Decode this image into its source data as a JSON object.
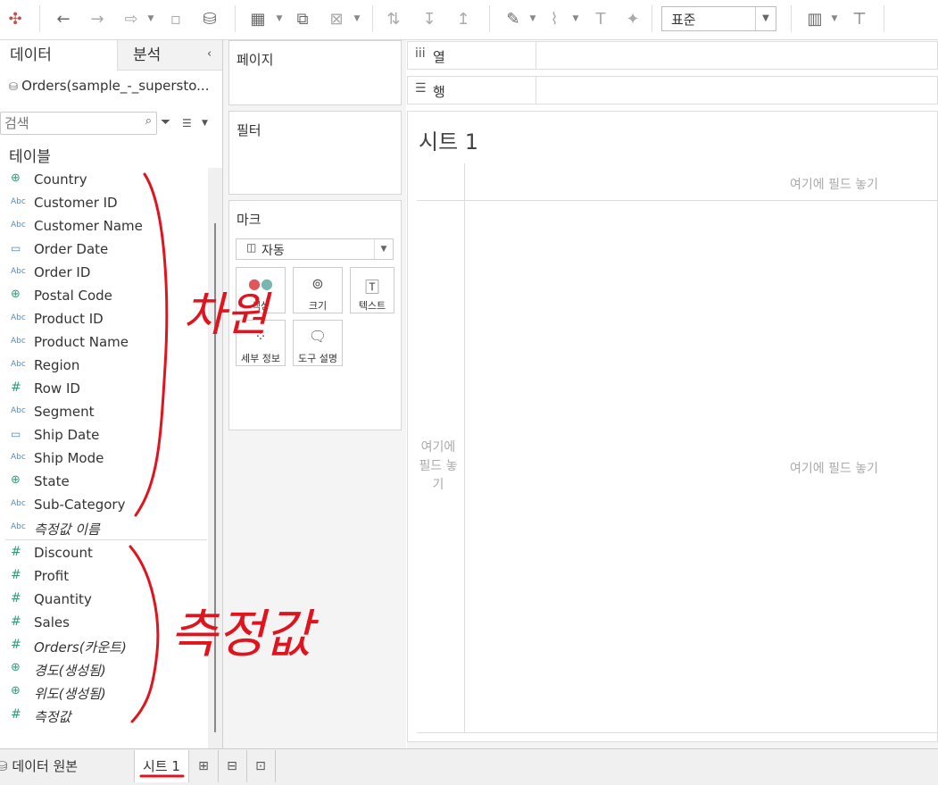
{
  "toolbar": {
    "buttons": [
      "tableau-logo-icon",
      "undo-icon",
      "redo-icon",
      "replay-icon",
      "save-icon",
      "new-datasource-icon",
      "new-worksheet-icon",
      "duplicate-icon",
      "clear-icon",
      "swap-icon",
      "sort-asc-icon",
      "sort-desc-icon",
      "highlight-icon",
      "group-icon",
      "labels-icon",
      "pin-icon",
      "show-me-icon",
      "presentation-icon"
    ],
    "fit_select": "표준"
  },
  "data_pane": {
    "tab_data": "데이터",
    "tab_analysis": "분석",
    "datasource": "Orders(sample_-_supersto...",
    "search_placeholder": "검색",
    "tables_label": "테이블",
    "dimensions": [
      {
        "type": "geo",
        "icon": "⊕",
        "name": "Country"
      },
      {
        "type": "abc",
        "icon": "Abc",
        "name": "Customer ID"
      },
      {
        "type": "abc",
        "icon": "Abc",
        "name": "Customer Name"
      },
      {
        "type": "date",
        "icon": "▭",
        "name": "Order Date"
      },
      {
        "type": "abc",
        "icon": "Abc",
        "name": "Order ID"
      },
      {
        "type": "geo",
        "icon": "⊕",
        "name": "Postal Code"
      },
      {
        "type": "abc",
        "icon": "Abc",
        "name": "Product ID"
      },
      {
        "type": "abc",
        "icon": "Abc",
        "name": "Product Name"
      },
      {
        "type": "abc",
        "icon": "Abc",
        "name": "Region"
      },
      {
        "type": "num",
        "icon": "#",
        "name": "Row ID"
      },
      {
        "type": "abc",
        "icon": "Abc",
        "name": "Segment"
      },
      {
        "type": "date",
        "icon": "▭",
        "name": "Ship Date"
      },
      {
        "type": "abc",
        "icon": "Abc",
        "name": "Ship Mode"
      },
      {
        "type": "geo",
        "icon": "⊕",
        "name": "State"
      },
      {
        "type": "abc",
        "icon": "Abc",
        "name": "Sub-Category"
      },
      {
        "type": "abc",
        "icon": "Abc",
        "name": "측정값 이름",
        "italic": true
      }
    ],
    "measures": [
      {
        "type": "num",
        "icon": "#",
        "name": "Discount"
      },
      {
        "type": "num",
        "icon": "#",
        "name": "Profit"
      },
      {
        "type": "num",
        "icon": "#",
        "name": "Quantity"
      },
      {
        "type": "num",
        "icon": "#",
        "name": "Sales"
      },
      {
        "type": "num",
        "icon": "#",
        "name": "Orders(카운트)",
        "italic": true
      },
      {
        "type": "geo",
        "icon": "⊕",
        "name": "경도(생성됨)",
        "italic": true
      },
      {
        "type": "geo",
        "icon": "⊕",
        "name": "위도(생성됨)",
        "italic": true
      },
      {
        "type": "num",
        "icon": "#",
        "name": "측정값",
        "italic": true
      }
    ]
  },
  "shelves": {
    "pages": "페이지",
    "filters": "필터",
    "marks": "마크",
    "marks_type": "자동",
    "mark_buttons": [
      "색상",
      "크기",
      "텍스트",
      "세부 정보",
      "도구 설명"
    ],
    "columns": "열",
    "rows": "행"
  },
  "canvas": {
    "sheet_title": "시트 1",
    "drop_top": "여기에 필드 놓기",
    "drop_center": "여기에 필드 놓기",
    "drop_rows": "여기에 필드 놓기"
  },
  "bottom": {
    "datasource_tab": "데이터 원본",
    "sheet_tab": "시트 1"
  },
  "annotations": {
    "dimensions_label": "차원",
    "measures_label": "측정값",
    "color": "#e0141e"
  }
}
